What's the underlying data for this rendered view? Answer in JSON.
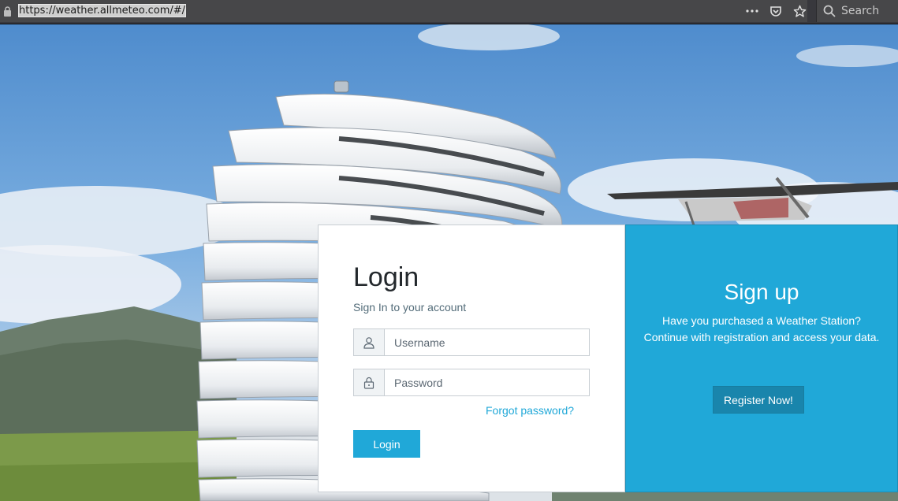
{
  "browser": {
    "url": "https://weather.allmeteo.com/#/",
    "search_label": "Search",
    "icons": [
      "lock-icon",
      "more-icon",
      "pocket-icon",
      "bookmark-star-icon",
      "search-icon"
    ]
  },
  "login": {
    "title": "Login",
    "subtitle": "Sign In to your account",
    "username_placeholder": "Username",
    "password_placeholder": "Password",
    "forgot_label": "Forgot password?",
    "submit_label": "Login"
  },
  "signup": {
    "title": "Sign up",
    "text": "Have you purchased a Weather Station? Continue with registration and access your data.",
    "register_label": "Register Now!"
  },
  "colors": {
    "primary": "#20a8d8",
    "register_button": "#1985ac",
    "chrome": "#38383d"
  }
}
